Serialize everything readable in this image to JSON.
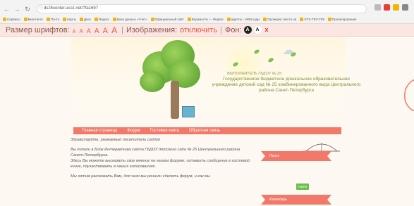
{
  "browser": {
    "url": "ds25center.ucoz.net/?fa1697",
    "bookmarks": [
      "Сервисы",
      "Вконтакте",
      "Почта",
      "Карты",
      "Диск",
      "Яндекс",
      "База данных «Учет»",
      "Официальный сайт",
      "Ведомости — Яндекс",
      "адепты - НКМ коды",
      "Проверка текста на",
      "GTS-TEV-T99",
      "Проектирование"
    ]
  },
  "a11y": {
    "font_size_label": "Размер шрифтов:",
    "sizes": [
      "А",
      "А",
      "А",
      "А",
      "А",
      "А"
    ],
    "images_label": "Изображения:",
    "images_value": "отключить",
    "background_label": "Фон:",
    "bg_black": "A",
    "bg_white": "A",
    "bg_reset": "x"
  },
  "header": {
    "school_short": "ВЫПОЛНИТЕЛЬ ГБДОУ № 25",
    "school_full": "Государственное бюджетное дошкольное образовательное учреждение детский сад № 25 комбинированного вида Центрального района Санкт-Петербурга"
  },
  "menu": [
    "Главная страница",
    "Форум",
    "Гостевая книга",
    "Обратная связь"
  ],
  "content": {
    "greeting": "Здравствуйте, уважаемый посетитель сайта!",
    "p1": "Вы попали в Блок Интерактива  сайта ГБДОУ детского сада № 25 Центрального района Санкт-Петербурга.",
    "p2": "Здесь Вы можете высказать свое мнение на нашем форуме, оставить сообщение в гостевой книге, поучаствовать в наших голосованиях.",
    "p3": "Мы хотим рассказать Вам, для чего мы решили сделать форум, и как мы"
  },
  "sidebar": {
    "ribbon1": "Поиск",
    "login_button": "Найти",
    "ribbon2": "Календарь"
  }
}
